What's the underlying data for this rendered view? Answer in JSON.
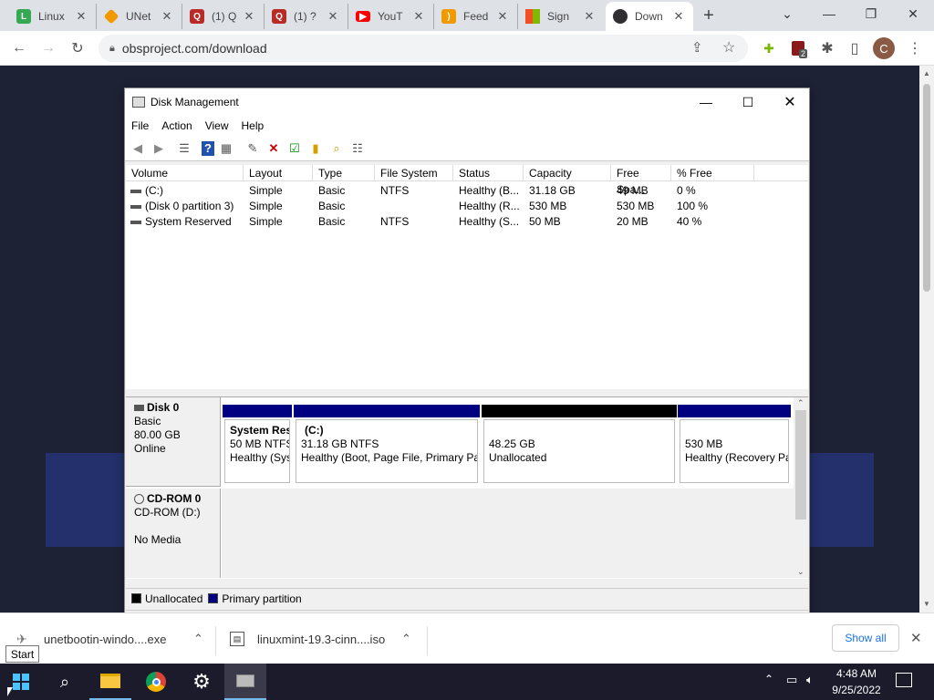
{
  "browser": {
    "tabs": [
      {
        "title": "Linux",
        "icon": "linux-favicon",
        "color": "#34a853"
      },
      {
        "title": "UNet",
        "icon": "unetbootin-favicon",
        "color": "#f29900"
      },
      {
        "title": "(1) Q",
        "icon": "quora-favicon",
        "color": "#b92b27"
      },
      {
        "title": "(1) ?",
        "icon": "quora-favicon",
        "color": "#b92b27"
      },
      {
        "title": "YouT",
        "icon": "youtube-favicon",
        "color": "#ff0000"
      },
      {
        "title": "Feed",
        "icon": "rss-favicon",
        "color": "#f29900"
      },
      {
        "title": "Sign",
        "icon": "microsoft-favicon",
        "color": "#00a4ef"
      },
      {
        "title": "Down",
        "icon": "obs-favicon",
        "color": "#302e31"
      }
    ],
    "new_tab": "+",
    "url": "obsproject.com/download",
    "profile_initial": "C",
    "extension_badge": "2"
  },
  "disk_management": {
    "title": "Disk Management",
    "menu": [
      "File",
      "Action",
      "View",
      "Help"
    ],
    "columns": [
      "Volume",
      "Layout",
      "Type",
      "File System",
      "Status",
      "Capacity",
      "Free Spa...",
      "% Free"
    ],
    "rows": [
      [
        "(C:)",
        "Simple",
        "Basic",
        "NTFS",
        "Healthy (B...",
        "31.18 GB",
        "49 MB",
        "0 %"
      ],
      [
        "(Disk 0 partition 3)",
        "Simple",
        "Basic",
        "",
        "Healthy (R...",
        "530 MB",
        "530 MB",
        "100 %"
      ],
      [
        "System Reserved",
        "Simple",
        "Basic",
        "NTFS",
        "Healthy (S...",
        "50 MB",
        "20 MB",
        "40 %"
      ]
    ],
    "disk0": {
      "name": "Disk 0",
      "type": "Basic",
      "size": "80.00 GB",
      "state": "Online",
      "partitions": [
        {
          "name": "System Res",
          "line2": "50 MB NTFS",
          "line3": "Healthy (Sys",
          "kind": "primary"
        },
        {
          "name": "(C:)",
          "line2": "31.18 GB NTFS",
          "line3": "Healthy (Boot, Page File, Primary Pa",
          "kind": "primary"
        },
        {
          "name": "",
          "line2": "48.25 GB",
          "line3": "Unallocated",
          "kind": "unallocated"
        },
        {
          "name": "",
          "line2": "530 MB",
          "line3": "Healthy (Recovery Pa",
          "kind": "primary"
        }
      ]
    },
    "cdrom": {
      "name": "CD-ROM 0",
      "line2": "CD-ROM (D:)",
      "line3": "No Media"
    },
    "legend": {
      "unallocated": "Unallocated",
      "primary": "Primary partition"
    },
    "colors": {
      "primary": "#000080",
      "unallocated": "#000000"
    }
  },
  "downloads": {
    "items": [
      {
        "name": "unetbootin-windo....exe"
      },
      {
        "name": "linuxmint-19.3-cinn....iso"
      }
    ],
    "show_all": "Show all"
  },
  "taskbar": {
    "start_tooltip": "Start",
    "time": "4:48 AM",
    "date": "9/25/2022"
  }
}
